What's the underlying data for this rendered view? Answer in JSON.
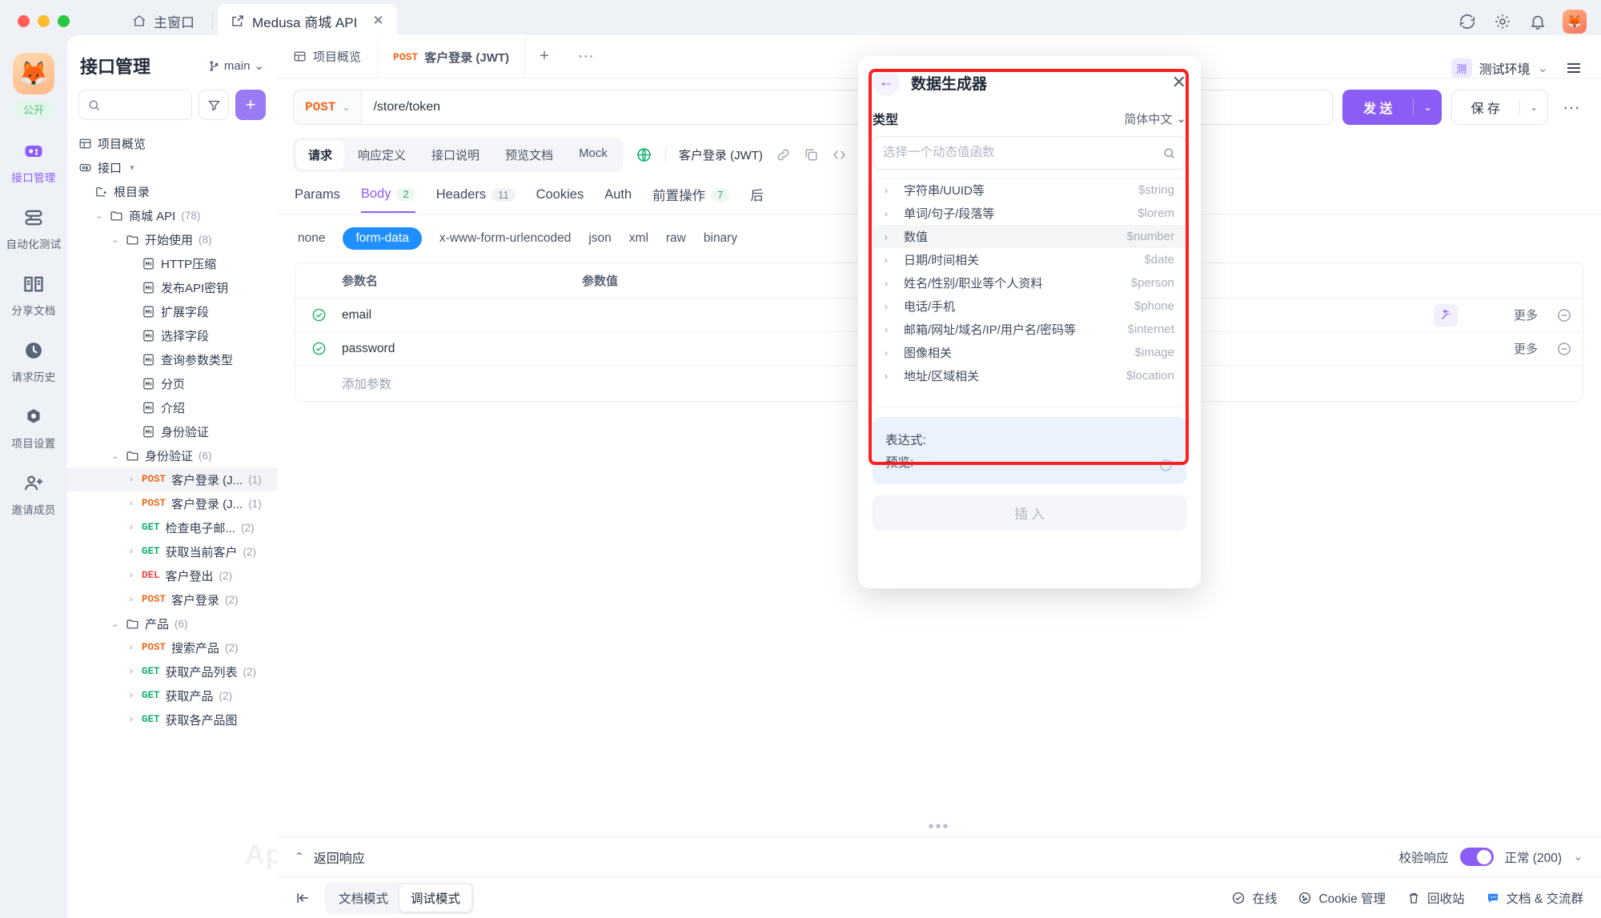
{
  "window": {
    "home_tab": "主窗口",
    "project_tab": "Medusa 商城 API",
    "close_label": "✕"
  },
  "rail": {
    "badge": "公开",
    "items": [
      {
        "label": "接口管理",
        "icon": "api-icon",
        "active": true
      },
      {
        "label": "自动化测试",
        "icon": "automation-icon",
        "active": false
      },
      {
        "label": "分享文档",
        "icon": "docs-icon",
        "active": false
      },
      {
        "label": "请求历史",
        "icon": "clock-icon",
        "active": false
      },
      {
        "label": "项目设置",
        "icon": "gear-icon",
        "active": false
      },
      {
        "label": "邀请成员",
        "icon": "invite-icon",
        "active": false
      }
    ]
  },
  "panel": {
    "title": "接口管理",
    "branch": "main",
    "search_placeholder": "",
    "tree": [
      {
        "depth": 0,
        "icon": "overview-icon",
        "label": "项目概览",
        "type": "nav"
      },
      {
        "depth": 0,
        "icon": "api-icon",
        "label": "接口",
        "type": "nav",
        "caret": "▾"
      },
      {
        "depth": 1,
        "icon": "root-icon",
        "label": "根目录",
        "type": "folder-plain"
      },
      {
        "depth": 1,
        "icon": "folder-icon",
        "label": "商城 API",
        "count": "(78)",
        "type": "folder",
        "chev": "⌄"
      },
      {
        "depth": 2,
        "icon": "folder-icon",
        "label": "开始使用",
        "count": "(8)",
        "type": "folder",
        "chev": "⌄"
      },
      {
        "depth": 3,
        "icon": "md-icon",
        "label": "HTTP压缩",
        "type": "doc"
      },
      {
        "depth": 3,
        "icon": "md-icon",
        "label": "发布API密钥",
        "type": "doc"
      },
      {
        "depth": 3,
        "icon": "md-icon",
        "label": "扩展字段",
        "type": "doc"
      },
      {
        "depth": 3,
        "icon": "md-icon",
        "label": "选择字段",
        "type": "doc"
      },
      {
        "depth": 3,
        "icon": "md-icon",
        "label": "查询参数类型",
        "type": "doc"
      },
      {
        "depth": 3,
        "icon": "md-icon",
        "label": "分页",
        "type": "doc"
      },
      {
        "depth": 3,
        "icon": "md-icon",
        "label": "介绍",
        "type": "doc"
      },
      {
        "depth": 3,
        "icon": "md-icon",
        "label": "身份验证",
        "type": "doc"
      },
      {
        "depth": 2,
        "icon": "folder-icon",
        "label": "身份验证",
        "count": "(6)",
        "type": "folder",
        "chev": "⌄"
      },
      {
        "depth": 3,
        "method": "POST",
        "label": "客户登录 (J...",
        "count": "(1)",
        "type": "api",
        "selected": true
      },
      {
        "depth": 3,
        "method": "POST",
        "label": "客户登录 (J...",
        "count": "(1)",
        "type": "api"
      },
      {
        "depth": 3,
        "method": "GET",
        "label": "检查电子邮...",
        "count": "(2)",
        "type": "api"
      },
      {
        "depth": 3,
        "method": "GET",
        "label": "获取当前客户",
        "count": "(2)",
        "type": "api"
      },
      {
        "depth": 3,
        "method": "DEL",
        "label": "客户登出",
        "count": "(2)",
        "type": "api"
      },
      {
        "depth": 3,
        "method": "POST",
        "label": "客户登录",
        "count": "(2)",
        "type": "api"
      },
      {
        "depth": 2,
        "icon": "folder-icon",
        "label": "产品",
        "count": "(6)",
        "type": "folder",
        "chev": "⌄"
      },
      {
        "depth": 3,
        "method": "POST",
        "label": "搜索产品",
        "count": "(2)",
        "type": "api"
      },
      {
        "depth": 3,
        "method": "GET",
        "label": "获取产品列表",
        "count": "(2)",
        "type": "api"
      },
      {
        "depth": 3,
        "method": "GET",
        "label": "获取产品",
        "count": "(2)",
        "type": "api"
      },
      {
        "depth": 3,
        "method": "GET",
        "label": "获取各产品图",
        "type": "api"
      }
    ]
  },
  "main": {
    "tabs": [
      {
        "label": "项目概览",
        "icon": "overview-icon",
        "active": false
      },
      {
        "label": "客户登录 (JWT)",
        "method": "POST",
        "active": true
      }
    ],
    "add_tab": "+",
    "more_tab": "···",
    "env": {
      "tag": "测",
      "name": "测试环境"
    },
    "request": {
      "method": "POST",
      "url": "/store/token",
      "send_label": "发 送",
      "save_label": "保 存"
    },
    "view_tabs": [
      {
        "label": "请求",
        "active": true
      },
      {
        "label": "响应定义",
        "active": false
      },
      {
        "label": "接口说明",
        "active": false
      },
      {
        "label": "预览文档",
        "active": false
      },
      {
        "label": "Mock",
        "active": false
      }
    ],
    "breadcrumb": "客户登录 (JWT)",
    "param_tabs": [
      {
        "label": "Params",
        "count": "",
        "active": false
      },
      {
        "label": "Body",
        "count": "2",
        "active": true
      },
      {
        "label": "Headers",
        "count": "11",
        "active": false
      },
      {
        "label": "Cookies",
        "count": "",
        "active": false
      },
      {
        "label": "Auth",
        "count": "",
        "active": false
      },
      {
        "label": "前置操作",
        "count": "7",
        "active": false
      },
      {
        "label": "后",
        "count": "",
        "active": false
      }
    ],
    "body_types": [
      {
        "label": "none",
        "active": false
      },
      {
        "label": "form-data",
        "active": true
      },
      {
        "label": "x-www-form-urlencoded",
        "active": false
      },
      {
        "label": "json",
        "active": false
      },
      {
        "label": "xml",
        "active": false
      },
      {
        "label": "raw",
        "active": false
      },
      {
        "label": "binary",
        "active": false
      }
    ],
    "table": {
      "headers": {
        "name": "参数名",
        "value": "参数值"
      },
      "rows": [
        {
          "name": "email",
          "value": "",
          "more": "更多"
        },
        {
          "name": "password",
          "value": "",
          "more": "更多"
        }
      ],
      "add_row": "添加参数"
    },
    "response": {
      "title": "返回响应",
      "validate_label": "校验响应",
      "status": "正常 (200)"
    },
    "statusbar": {
      "collapse_icon": "collapse-icon",
      "modes": [
        {
          "label": "文档模式",
          "active": false
        },
        {
          "label": "调试模式",
          "active": true
        }
      ],
      "right_items": [
        {
          "label": "在线",
          "icon": "check-circle-icon"
        },
        {
          "label": "Cookie 管理",
          "icon": "cookie-icon"
        },
        {
          "label": "回收站",
          "icon": "trash-icon"
        },
        {
          "label": "文档 & 交流群",
          "icon": "chat-icon"
        }
      ]
    }
  },
  "modal": {
    "back_icon": "back-arrow-icon",
    "title": "数据生成器",
    "close_icon": "close-icon",
    "type_label": "类型",
    "language": "简体中文",
    "search_placeholder": "选择一个动态值函数",
    "functions": [
      {
        "label": "字符串/UUID等",
        "code": "$string",
        "highlighted": false
      },
      {
        "label": "单词/句子/段落等",
        "code": "$lorem",
        "highlighted": false
      },
      {
        "label": "数值",
        "code": "$number",
        "highlighted": true
      },
      {
        "label": "日期/时间相关",
        "code": "$date",
        "highlighted": false
      },
      {
        "label": "姓名/性别/职业等个人资料",
        "code": "$person",
        "highlighted": false
      },
      {
        "label": "电话/手机",
        "code": "$phone",
        "highlighted": false
      },
      {
        "label": "邮箱/网址/域名/IP/用户名/密码等",
        "code": "$internet",
        "highlighted": false
      },
      {
        "label": "图像相关",
        "code": "$image",
        "highlighted": false
      },
      {
        "label": "地址/区域相关",
        "code": "$location",
        "highlighted": false
      }
    ],
    "expression_label": "表达式:",
    "preview_label": "预览:",
    "insert_label": "插 入"
  },
  "watermark": "Apifox",
  "colors": {
    "accent": "#8b5cf6",
    "post": "#f2691a",
    "get": "#10b070",
    "del": "#ef4444",
    "highlight_border": "#ff1f1f",
    "form_data_active": "#1f8fff"
  }
}
